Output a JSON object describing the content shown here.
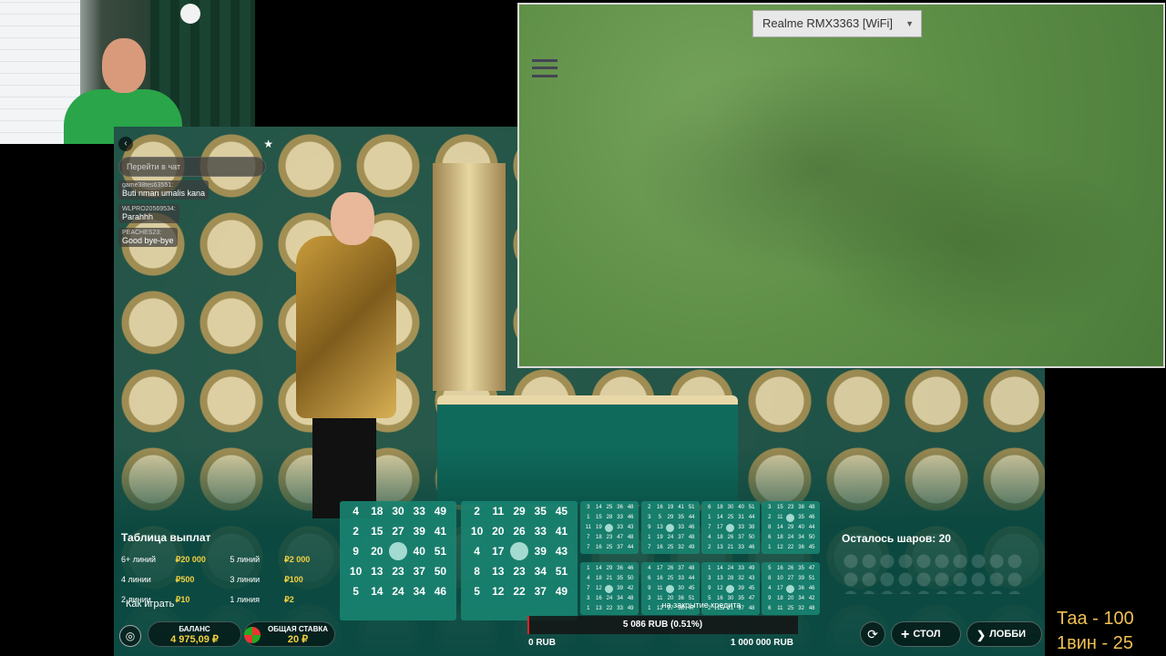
{
  "chat": {
    "input_placeholder": "Перейти в чат",
    "messages": [
      {
        "author": "game38tes63551:",
        "text": "Buti nman umalis kana"
      },
      {
        "author": "WLPRO20569534:",
        "text": "Parahhh"
      },
      {
        "author": "PEACHES23:",
        "text": "Good bye-bye"
      }
    ]
  },
  "phone": {
    "device_name": "Realme RMX3363 [WiFi]"
  },
  "payout": {
    "title": "Таблица выплат",
    "rows": [
      {
        "l1": "6+ линий",
        "a1": "₽20 000",
        "l2": "5 линий",
        "a2": "₽2 000"
      },
      {
        "l1": "4 линии",
        "a1": "₽500",
        "l2": "3 линии",
        "a2": "₽100"
      },
      {
        "l1": "2 линии",
        "a1": "₽10",
        "l2": "1 линия",
        "a2": "₽2"
      }
    ],
    "how_to_play": "Как играть"
  },
  "cards": {
    "big": [
      {
        "cells": [
          "4",
          "18",
          "30",
          "33",
          "49",
          "2",
          "15",
          "27",
          "39",
          "41",
          "9",
          "20",
          "",
          "40",
          "51",
          "10",
          "13",
          "23",
          "37",
          "50",
          "5",
          "14",
          "24",
          "34",
          "46"
        ],
        "marked": [
          12
        ]
      },
      {
        "cells": [
          "2",
          "11",
          "29",
          "35",
          "45",
          "10",
          "20",
          "26",
          "33",
          "41",
          "4",
          "17",
          "",
          "39",
          "43",
          "8",
          "13",
          "23",
          "34",
          "51",
          "5",
          "12",
          "22",
          "37",
          "49"
        ],
        "marked": [
          12
        ]
      }
    ],
    "small": [
      {
        "cells": [
          "3",
          "14",
          "25",
          "36",
          "48",
          "1",
          "15",
          "28",
          "33",
          "46",
          "11",
          "19",
          "",
          "33",
          "43",
          "7",
          "18",
          "23",
          "47",
          "48",
          "7",
          "16",
          "25",
          "37",
          "44"
        ],
        "marked": [
          12
        ]
      },
      {
        "cells": [
          "2",
          "16",
          "19",
          "41",
          "51",
          "3",
          "5",
          "29",
          "35",
          "44",
          "9",
          "13",
          "",
          "33",
          "46",
          "1",
          "19",
          "24",
          "37",
          "48",
          "7",
          "16",
          "25",
          "32",
          "49"
        ],
        "marked": [
          12
        ]
      },
      {
        "cells": [
          "6",
          "18",
          "30",
          "40",
          "51",
          "1",
          "14",
          "25",
          "31",
          "44",
          "7",
          "17",
          "",
          "33",
          "38",
          "4",
          "18",
          "26",
          "37",
          "50",
          "2",
          "13",
          "21",
          "33",
          "46"
        ],
        "marked": [
          12
        ]
      },
      {
        "cells": [
          "3",
          "15",
          "23",
          "38",
          "48",
          "2",
          "11",
          "",
          "35",
          "46",
          "8",
          "14",
          "29",
          "40",
          "44",
          "6",
          "18",
          "24",
          "34",
          "50",
          "1",
          "12",
          "22",
          "36",
          "45"
        ],
        "marked": [
          7
        ]
      },
      {
        "cells": [
          "1",
          "14",
          "29",
          "36",
          "46",
          "4",
          "18",
          "21",
          "35",
          "50",
          "7",
          "12",
          "",
          "39",
          "42",
          "3",
          "16",
          "24",
          "34",
          "48",
          "1",
          "13",
          "22",
          "33",
          "49"
        ],
        "marked": [
          12
        ]
      },
      {
        "cells": [
          "4",
          "17",
          "26",
          "37",
          "48",
          "6",
          "16",
          "25",
          "33",
          "44",
          "9",
          "11",
          "",
          "30",
          "45",
          "3",
          "11",
          "20",
          "36",
          "51",
          "1",
          "12",
          "27",
          "38",
          "47"
        ],
        "marked": [
          12
        ]
      },
      {
        "cells": [
          "1",
          "14",
          "24",
          "33",
          "49",
          "3",
          "13",
          "28",
          "32",
          "43",
          "9",
          "12",
          "",
          "39",
          "45",
          "5",
          "16",
          "30",
          "35",
          "47",
          "2",
          "15",
          "21",
          "37",
          "48"
        ],
        "marked": [
          12
        ]
      },
      {
        "cells": [
          "5",
          "16",
          "26",
          "35",
          "47",
          "8",
          "10",
          "27",
          "39",
          "51",
          "4",
          "17",
          "",
          "36",
          "46",
          "9",
          "18",
          "20",
          "34",
          "42",
          "6",
          "11",
          "25",
          "32",
          "48"
        ],
        "marked": [
          12
        ]
      }
    ],
    "caption": "на закрытие кредита"
  },
  "balls_left": "Осталось шаров: 20",
  "bottom": {
    "balance_label": "БАЛАНС",
    "balance_value": "4 975,09 ₽",
    "bet_label": "ОБЩАЯ СТАВКА",
    "bet_value": "20 ₽",
    "progress_text": "5 086 RUB (0.51%)",
    "progress_fraction": 0.0051,
    "progress_min": "0 RUB",
    "progress_max": "1 000 000 RUB",
    "table_button": "СТОЛ",
    "lobby_button": "ЛОББИ"
  },
  "overlay": {
    "line1": "Таа - 100",
    "line2": "1вин - 25"
  },
  "colors": {
    "accent_gold": "#f3d23e",
    "card_teal": "#198270",
    "progress_red": "#e22222"
  }
}
